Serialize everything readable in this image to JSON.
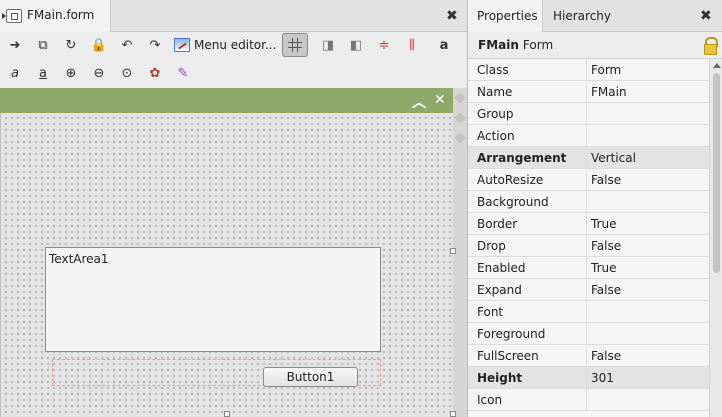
{
  "editor": {
    "tab_label": "FMain.form",
    "close_glyph": "✖",
    "menu_editor_label": "Menu editor..."
  },
  "form": {
    "textarea_label": "TextArea1",
    "button_label": "Button1"
  },
  "properties": {
    "tabs": [
      "Properties",
      "Hierarchy"
    ],
    "close_glyph": "✖",
    "object_name": "FMain",
    "object_class": "Form",
    "rows": [
      {
        "name": "Class",
        "value": "Form"
      },
      {
        "name": "Name",
        "value": "FMain"
      },
      {
        "name": "Group",
        "value": ""
      },
      {
        "name": "Action",
        "value": ""
      },
      {
        "name": "Arrangement",
        "value": "Vertical"
      },
      {
        "name": "AutoResize",
        "value": "False"
      },
      {
        "name": "Background",
        "value": ""
      },
      {
        "name": "Border",
        "value": "True"
      },
      {
        "name": "Drop",
        "value": "False"
      },
      {
        "name": "Enabled",
        "value": "True"
      },
      {
        "name": "Expand",
        "value": "False"
      },
      {
        "name": "Font",
        "value": ""
      },
      {
        "name": "Foreground",
        "value": ""
      },
      {
        "name": "FullScreen",
        "value": "False"
      },
      {
        "name": "Height",
        "value": "301"
      },
      {
        "name": "Icon",
        "value": ""
      }
    ]
  },
  "colors": {
    "form_titlebar": "#8fa96b",
    "canvas_bg": "#e3e3e3",
    "group_row": "#e3e3e3"
  }
}
